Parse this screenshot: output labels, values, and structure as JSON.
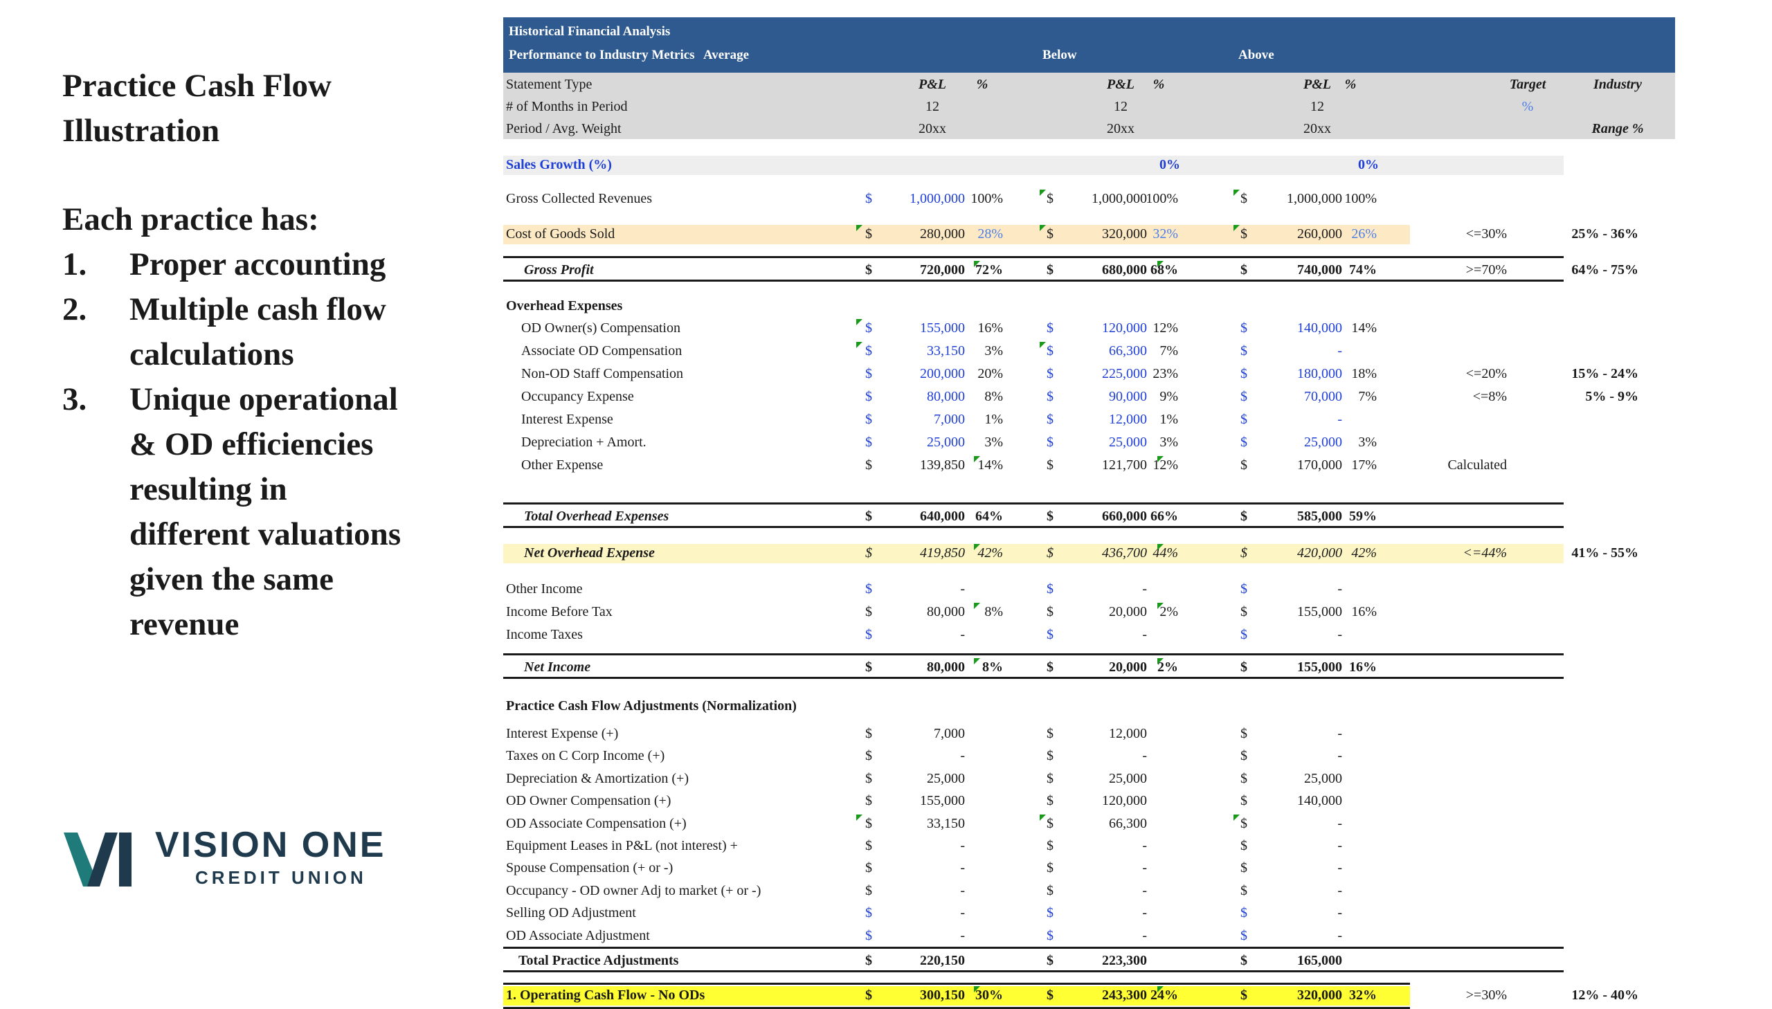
{
  "slide": {
    "title_line1": "Practice Cash Flow",
    "title_line2": "Illustration",
    "has_heading": "Each practice has:",
    "points": [
      {
        "num": "1.",
        "lines": [
          "Proper accounting"
        ]
      },
      {
        "num": "2.",
        "lines": [
          "Multiple cash flow",
          "calculations"
        ]
      },
      {
        "num": "3.",
        "lines": [
          "Unique operational",
          "& OD efficiencies",
          "resulting in",
          "different valuations",
          "given the same",
          "revenue"
        ]
      }
    ]
  },
  "logo": {
    "mark": "VI",
    "name": "VISION ONE",
    "sub": "CREDIT UNION",
    "color": "#1e3a4c",
    "accent": "#1f7a7a"
  },
  "table": {
    "header": {
      "line1": "Historical Financial Analysis",
      "line2": "Performance to Industry Metrics",
      "col_average": "Average",
      "col_below": "Below",
      "col_above": "Above"
    },
    "info_rows": {
      "statement_label": "Statement Type",
      "pl": "P&L",
      "pct": "%",
      "target": "Target",
      "industry": "Industry",
      "months_label": "# of Months in Period",
      "months": "12",
      "target_pct": "%",
      "period_label": "Period / Avg. Weight",
      "period": "20xx",
      "range": "Range %"
    },
    "sales_growth": {
      "label": "Sales Growth (%)",
      "below_pct": "0%",
      "above_pct": "0%"
    },
    "gross_collected": {
      "label": "Gross Collected Revenues",
      "avg": "1,000,000",
      "avg_pct": "100%",
      "below": "1,000,000",
      "below_pct": "100%",
      "above": "1,000,000",
      "above_pct": "100%"
    },
    "cogs": {
      "label": "Cost of Goods Sold",
      "avg": "280,000",
      "avg_pct": "28%",
      "below": "320,000",
      "below_pct": "32%",
      "above": "260,000",
      "above_pct": "26%",
      "target": "<=30%",
      "industry": "25% - 36%"
    },
    "gross_profit": {
      "label": "Gross Profit",
      "avg": "720,000",
      "avg_pct": "72%",
      "below": "680,000",
      "below_pct": "68%",
      "above": "740,000",
      "above_pct": "74%",
      "target": ">=70%",
      "industry": "64% - 75%"
    },
    "overhead_heading": "Overhead Expenses",
    "overhead": [
      {
        "label": "OD Owner(s) Compensation",
        "avg": "155,000",
        "avg_pct": "16%",
        "below": "120,000",
        "below_pct": "12%",
        "above": "140,000",
        "above_pct": "14%",
        "target": "",
        "industry": ""
      },
      {
        "label": "Associate OD Compensation",
        "avg": "33,150",
        "avg_pct": "3%",
        "below": "66,300",
        "below_pct": "7%",
        "above": "-",
        "above_pct": "",
        "target": "",
        "industry": ""
      },
      {
        "label": "Non-OD Staff Compensation",
        "avg": "200,000",
        "avg_pct": "20%",
        "below": "225,000",
        "below_pct": "23%",
        "above": "180,000",
        "above_pct": "18%",
        "target": "<=20%",
        "industry": "15% - 24%"
      },
      {
        "label": "Occupancy Expense",
        "avg": "80,000",
        "avg_pct": "8%",
        "below": "90,000",
        "below_pct": "9%",
        "above": "70,000",
        "above_pct": "7%",
        "target": "<=8%",
        "industry": "5% - 9%"
      },
      {
        "label": "Interest Expense",
        "avg": "7,000",
        "avg_pct": "1%",
        "below": "12,000",
        "below_pct": "1%",
        "above": "-",
        "above_pct": "",
        "target": "",
        "industry": ""
      },
      {
        "label": "Depreciation + Amort.",
        "avg": "25,000",
        "avg_pct": "3%",
        "below": "25,000",
        "below_pct": "3%",
        "above": "25,000",
        "above_pct": "3%",
        "target": "",
        "industry": ""
      },
      {
        "label": "Other Expense",
        "avg": "139,850",
        "avg_pct": "14%",
        "below": "121,700",
        "below_pct": "12%",
        "above": "170,000",
        "above_pct": "17%",
        "target": "Calculated",
        "industry": ""
      }
    ],
    "total_overhead": {
      "label": "Total  Overhead Expenses",
      "avg": "640,000",
      "avg_pct": "64%",
      "below": "660,000",
      "below_pct": "66%",
      "above": "585,000",
      "above_pct": "59%"
    },
    "net_overhead": {
      "label": "Net Overhead Expense",
      "avg": "419,850",
      "avg_pct": "42%",
      "below": "436,700",
      "below_pct": "44%",
      "above": "420,000",
      "above_pct": "42%",
      "target": "<=44%",
      "industry": "41% - 55%"
    },
    "other_income": {
      "label": "Other Income",
      "avg": "-",
      "below": "-",
      "above": "-"
    },
    "income_before_tax": {
      "label": "Income Before Tax",
      "avg": "80,000",
      "avg_pct": "8%",
      "below": "20,000",
      "below_pct": "2%",
      "above": "155,000",
      "above_pct": "16%"
    },
    "income_taxes": {
      "label": "Income Taxes",
      "avg": "-",
      "below": "-",
      "above": "-"
    },
    "net_income": {
      "label": "Net Income",
      "avg": "80,000",
      "avg_pct": "8%",
      "below": "20,000",
      "below_pct": "2%",
      "above": "155,000",
      "above_pct": "16%"
    },
    "adjustments_heading": "Practice Cash Flow Adjustments (Normalization)",
    "adjustments": [
      {
        "label": "Interest Expense (+)",
        "avg": "7,000",
        "below": "12,000",
        "above": "-"
      },
      {
        "label": "Taxes on C Corp Income (+)",
        "avg": "-",
        "below": "-",
        "above": "-"
      },
      {
        "label": "Depreciation & Amortization (+)",
        "avg": "25,000",
        "below": "25,000",
        "above": "25,000"
      },
      {
        "label": "OD Owner Compensation (+)",
        "avg": "155,000",
        "below": "120,000",
        "above": "140,000"
      },
      {
        "label": "OD Associate Compensation (+)",
        "avg": "33,150",
        "below": "66,300",
        "above": "-"
      },
      {
        "label": "Equipment Leases in P&L (not interest) +",
        "avg": "-",
        "below": "-",
        "above": "-"
      },
      {
        "label": "Spouse Compensation (+ or -)",
        "avg": "-",
        "below": "-",
        "above": "-"
      },
      {
        "label": "Occupancy - OD owner Adj to market (+ or -)",
        "avg": "-",
        "below": "-",
        "above": "-"
      },
      {
        "label": "Selling OD Adjustment",
        "avg": "-",
        "below": "-",
        "above": "-"
      },
      {
        "label": "OD Associate Adjustment",
        "avg": "-",
        "below": "-",
        "above": "-"
      }
    ],
    "total_adjustments": {
      "label": "Total Practice Adjustments",
      "avg": "220,150",
      "below": "223,300",
      "above": "165,000"
    },
    "operating_cash_flow": {
      "label": "1. Operating Cash Flow - No ODs",
      "avg": "300,150",
      "avg_pct": "30%",
      "below": "243,300",
      "below_pct": "24%",
      "above": "320,000",
      "above_pct": "32%",
      "target": ">=30%",
      "industry": "12% - 40%"
    },
    "currency_symbol": "$",
    "colors": {
      "header_bg": "#2f5a8f",
      "info_bg": "#d9d9d9",
      "cogs_highlight": "#fde9c4",
      "net_overhead_highlight": "#fdf6c4",
      "ocf_highlight": "#ffff33",
      "input_blue": "#1f3fd6",
      "marker_green": "#1a9a1a"
    }
  }
}
